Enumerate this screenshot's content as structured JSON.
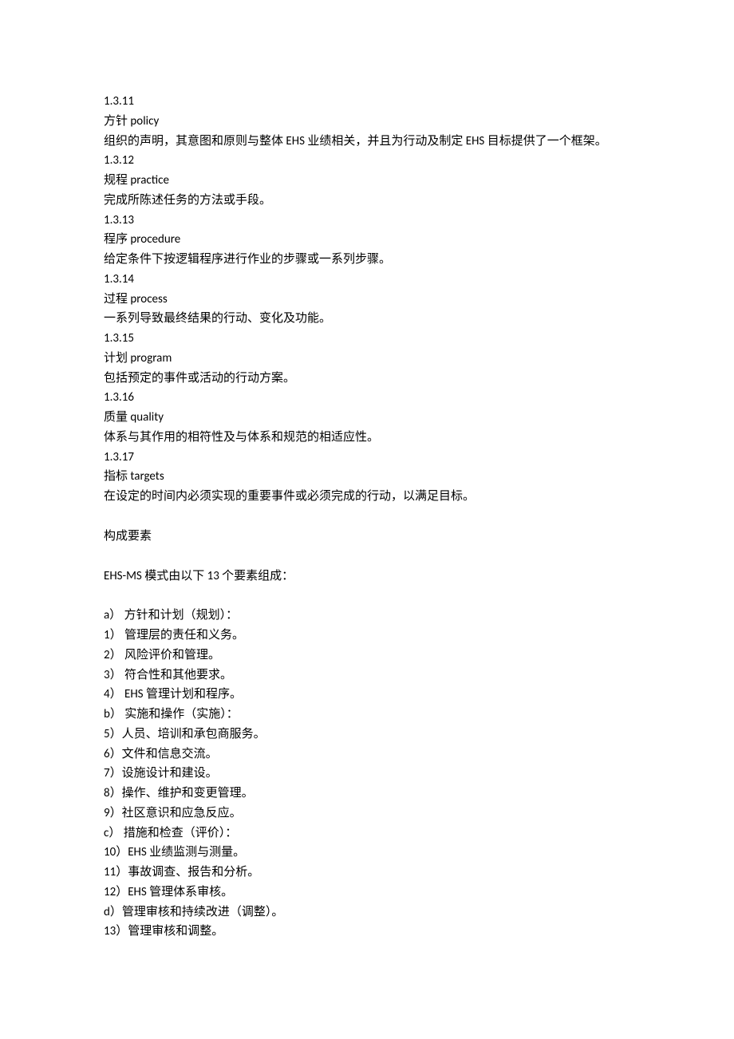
{
  "definitions": [
    {
      "number": "1.3.11",
      "term_cn": "方针",
      "term_en": "policy",
      "description": "组织的声明，其意图和原则与整体 EHS 业绩相关，并且为行动及制定 EHS 目标提供了一个框架。"
    },
    {
      "number": "1.3.12",
      "term_cn": "规程",
      "term_en": "practice",
      "description": "完成所陈述任务的方法或手段。"
    },
    {
      "number": "1.3.13",
      "term_cn": "程序",
      "term_en": "procedure",
      "description": "给定条件下按逻辑程序进行作业的步骤或一系列步骤。"
    },
    {
      "number": "1.3.14",
      "term_cn": "过程",
      "term_en": "process",
      "description": "一系列导致最终结果的行动、变化及功能。"
    },
    {
      "number": "1.3.15",
      "term_cn": "计划",
      "term_en": "program",
      "description": "包括预定的事件或活动的行动方案。"
    },
    {
      "number": "1.3.16",
      "term_cn": "质量",
      "term_en": "quality",
      "description": "体系与其作用的相符性及与体系和规范的相适应性。"
    },
    {
      "number": "1.3.17",
      "term_cn": "指标",
      "term_en": "targets",
      "description": "在设定的时间内必须实现的重要事件或必须完成的行动，以满足目标。"
    }
  ],
  "elements_heading": "构成要素",
  "elements_intro": "EHS-MS 模式由以下 13 个要素组成：",
  "elements_list": [
    "a）  方针和计划（规划）：",
    "1）  管理层的责任和义务。",
    "2）  风险评价和管理。",
    "3）  符合性和其他要求。",
    "4）  EHS 管理计划和程序。",
    "b）  实施和操作（实施）：",
    "5）人员、培训和承包商服务。",
    "6）文件和信息交流。",
    "7）设施设计和建设。",
    "8）操作、维护和变更管理。",
    "9）社区意识和应急反应。",
    "c）  措施和检查（评价）：",
    "10）EHS 业绩监测与测量。",
    "11）事故调查、报告和分析。",
    "12）EHS 管理体系审核。",
    "d）管理审核和持续改进（调整）。",
    "13）管理审核和调整。"
  ]
}
